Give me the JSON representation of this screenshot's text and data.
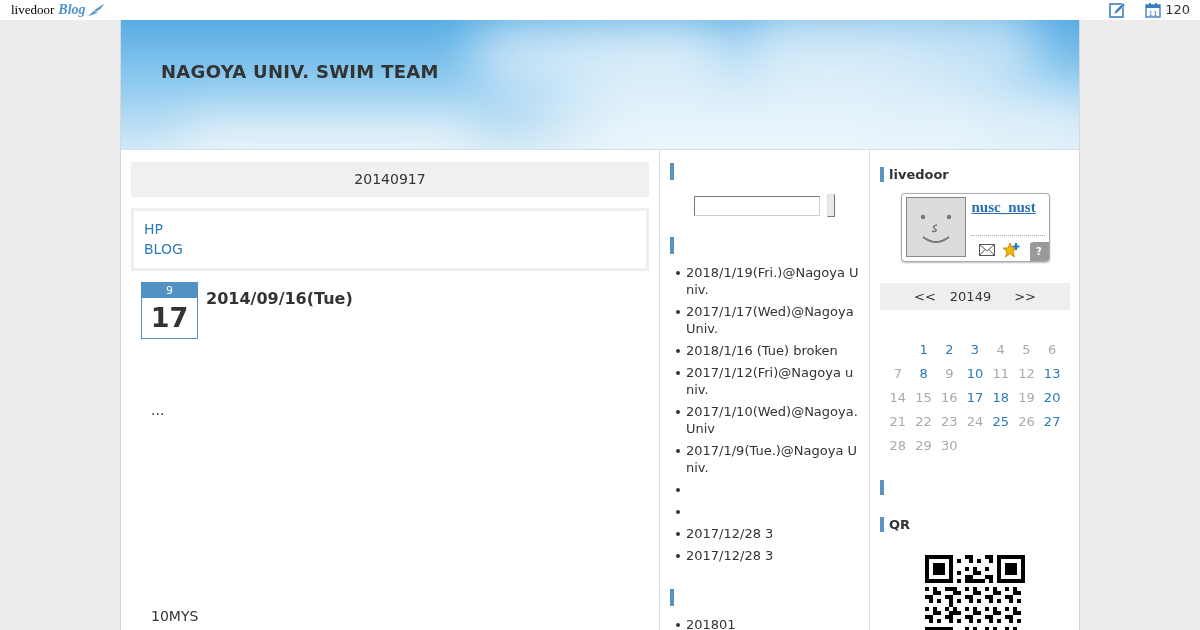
{
  "top_bar": {
    "logo": {
      "brand": "livedoor",
      "product": "Blog"
    },
    "calendar_icon_day": "11",
    "count": "120"
  },
  "header": {
    "title": "NAGOYA UNIV. SWIM TEAM"
  },
  "main": {
    "category_title": "20140917",
    "links": [
      "HP",
      "BLOG"
    ],
    "post": {
      "month": "9",
      "day": "17",
      "title": "2014/09/16(Tue)",
      "paragraphs": [
        "...",
        "10MYS"
      ]
    }
  },
  "middle_sidebar": [
    {
      "kind": "search",
      "marker": true
    },
    {
      "kind": "list",
      "marker": true,
      "items": [
        {
          "kind": "link",
          "text": "2018/1/19(Fri.)@Nagoya Univ."
        },
        {
          "kind": "link",
          "text": "2017/1/17(Wed)@Nagoya Univ."
        },
        {
          "kind": "link",
          "text": "2018/1/16 (Tue) broken"
        },
        {
          "kind": "link",
          "text": "2017/1/12(Fri)@Nagoya univ."
        },
        {
          "kind": "link",
          "text": "2017/1/10(Wed)@Nagoya.Univ"
        },
        {
          "kind": "link",
          "text": "2017/1/9(Tue.)@Nagoya Univ."
        },
        {
          "kind": "bullet_only"
        },
        {
          "kind": "bullet_only"
        },
        {
          "kind": "link",
          "text": "2017/12/28 3"
        },
        {
          "kind": "link",
          "text": "2017/12/28 3"
        }
      ]
    },
    {
      "kind": "list",
      "marker": true,
      "items": [
        {
          "kind": "link",
          "text": "201801"
        }
      ]
    }
  ],
  "right_sidebar": [
    {
      "kind": "profile",
      "marker": true,
      "title": "livedoor",
      "username": "nusc_nust",
      "help": "?"
    },
    {
      "kind": "calendar",
      "nav": {
        "prev": "<<",
        "label": "20149",
        "next": ">>"
      },
      "weeks": [
        [
          {
            "kind": "empty"
          },
          {
            "kind": "day",
            "day": "1",
            "linked": true
          },
          {
            "kind": "day",
            "day": "2",
            "linked": true
          },
          {
            "kind": "day",
            "day": "3",
            "linked": true
          },
          {
            "kind": "day",
            "day": "4",
            "linked": false
          },
          {
            "kind": "day",
            "day": "5",
            "linked": false
          },
          {
            "kind": "day",
            "day": "6",
            "linked": false
          }
        ],
        [
          {
            "kind": "day",
            "day": "7",
            "linked": false
          },
          {
            "kind": "day",
            "day": "8",
            "linked": true
          },
          {
            "kind": "day",
            "day": "9",
            "linked": false
          },
          {
            "kind": "day",
            "day": "10",
            "linked": true
          },
          {
            "kind": "day",
            "day": "11",
            "linked": false
          },
          {
            "kind": "day",
            "day": "12",
            "linked": false
          },
          {
            "kind": "day",
            "day": "13",
            "linked": true
          }
        ],
        [
          {
            "kind": "day",
            "day": "14",
            "linked": false
          },
          {
            "kind": "day",
            "day": "15",
            "linked": false
          },
          {
            "kind": "day",
            "day": "16",
            "linked": false
          },
          {
            "kind": "day",
            "day": "17",
            "linked": true
          },
          {
            "kind": "day",
            "day": "18",
            "linked": true
          },
          {
            "kind": "day",
            "day": "19",
            "linked": false
          },
          {
            "kind": "day",
            "day": "20",
            "linked": true
          }
        ],
        [
          {
            "kind": "day",
            "day": "21",
            "linked": false
          },
          {
            "kind": "day",
            "day": "22",
            "linked": false
          },
          {
            "kind": "day",
            "day": "23",
            "linked": false
          },
          {
            "kind": "day",
            "day": "24",
            "linked": false
          },
          {
            "kind": "day",
            "day": "25",
            "linked": true
          },
          {
            "kind": "day",
            "day": "26",
            "linked": false
          },
          {
            "kind": "day",
            "day": "27",
            "linked": true
          }
        ],
        [
          {
            "kind": "day",
            "day": "28",
            "linked": false
          },
          {
            "kind": "day",
            "day": "29",
            "linked": false
          },
          {
            "kind": "day",
            "day": "30",
            "linked": false
          }
        ]
      ]
    },
    {
      "kind": "blank",
      "marker": true
    },
    {
      "kind": "qr",
      "marker": true,
      "title": "QR"
    }
  ]
}
